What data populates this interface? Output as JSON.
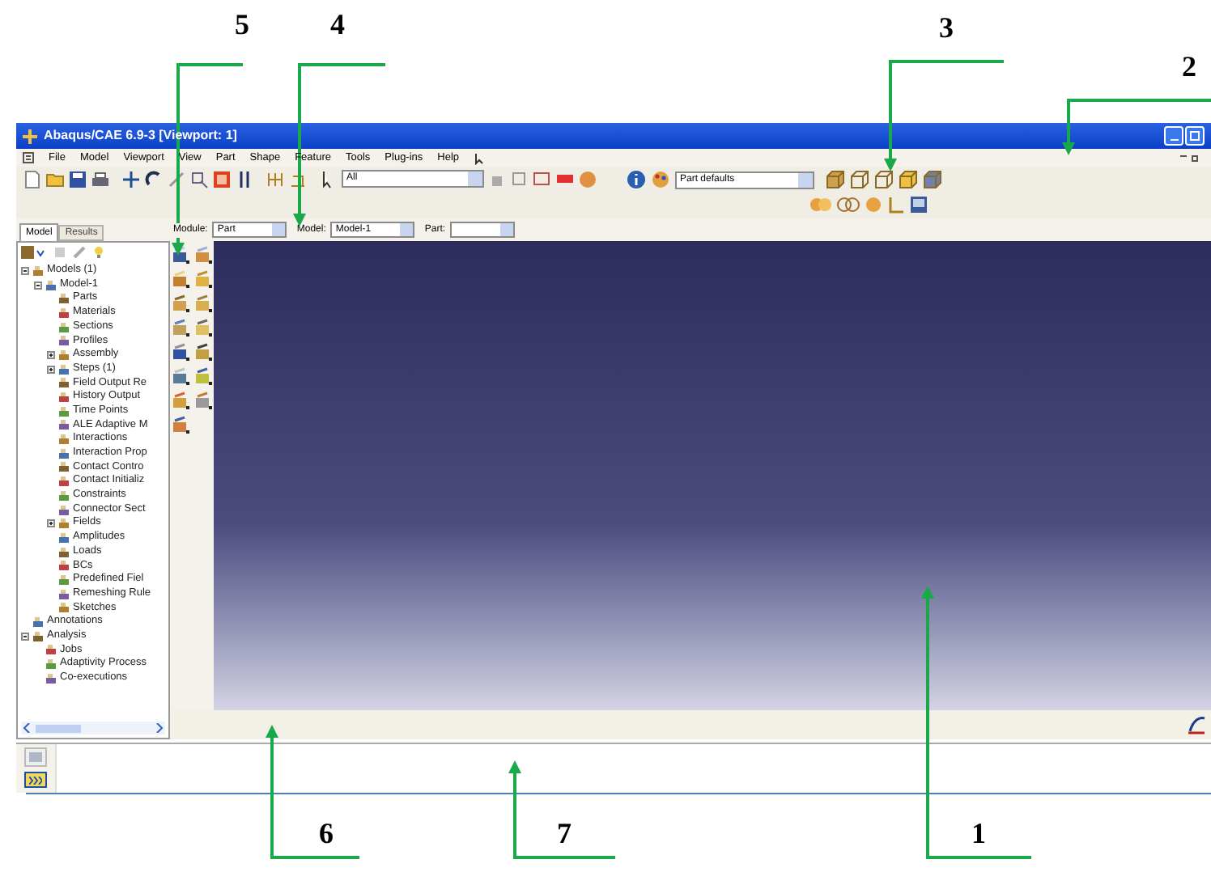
{
  "window": {
    "title": "Abaqus/CAE 6.9-3 [Viewport: 1]"
  },
  "menu": [
    "File",
    "Model",
    "Viewport",
    "View",
    "Part",
    "Shape",
    "Feature",
    "Tools",
    "Plug-ins",
    "Help"
  ],
  "toolbar": {
    "selection_filter": "All",
    "render_style": "Part defaults"
  },
  "context_bar": {
    "module_label": "Module:",
    "module": "Part",
    "model_label": "Model:",
    "model": "Model-1",
    "part_label": "Part:"
  },
  "tabs": [
    {
      "label": "Model",
      "selected": true
    },
    {
      "label": "Results",
      "selected": false
    }
  ],
  "tree": [
    {
      "label": "Models (1)",
      "expanded": true,
      "children": [
        {
          "label": "Model-1",
          "expanded": true,
          "children": [
            {
              "label": "Parts"
            },
            {
              "label": "Materials"
            },
            {
              "label": "Sections"
            },
            {
              "label": "Profiles"
            },
            {
              "label": "Assembly",
              "expanded": false
            },
            {
              "label": "Steps (1)",
              "expanded": false
            },
            {
              "label": "Field Output Re"
            },
            {
              "label": "History Output"
            },
            {
              "label": "Time Points"
            },
            {
              "label": "ALE Adaptive M"
            },
            {
              "label": "Interactions"
            },
            {
              "label": "Interaction Prop"
            },
            {
              "label": "Contact Contro"
            },
            {
              "label": "Contact Initializ"
            },
            {
              "label": "Constraints"
            },
            {
              "label": "Connector Sect"
            },
            {
              "label": "Fields",
              "expanded": false
            },
            {
              "label": "Amplitudes"
            },
            {
              "label": "Loads"
            },
            {
              "label": "BCs"
            },
            {
              "label": "Predefined Fiel"
            },
            {
              "label": "Remeshing Rule"
            },
            {
              "label": "Sketches"
            }
          ]
        }
      ]
    },
    {
      "label": "Annotations"
    },
    {
      "label": "Analysis",
      "expanded": true,
      "children": [
        {
          "label": "Jobs"
        },
        {
          "label": "Adaptivity Process"
        },
        {
          "label": "Co-executions"
        }
      ]
    }
  ],
  "callouts": [
    {
      "label": "5"
    },
    {
      "label": "4"
    },
    {
      "label": "3"
    },
    {
      "label": "2"
    },
    {
      "label": "6"
    },
    {
      "label": "7"
    },
    {
      "label": "1"
    }
  ]
}
